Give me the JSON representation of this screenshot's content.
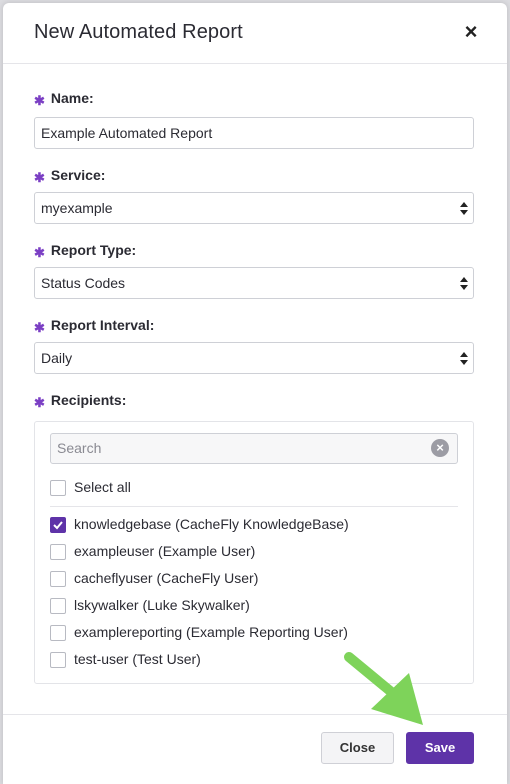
{
  "modal": {
    "title": "New Automated Report",
    "close_symbol": "×"
  },
  "form": {
    "required_marker": "✱",
    "name": {
      "label": "Name:",
      "value": "Example Automated Report"
    },
    "service": {
      "label": "Service:",
      "value": "myexample"
    },
    "report_type": {
      "label": "Report Type:",
      "value": "Status Codes"
    },
    "report_interval": {
      "label": "Report Interval:",
      "value": "Daily"
    },
    "recipients": {
      "label": "Recipients:",
      "search_placeholder": "Search",
      "select_all_label": "Select all",
      "users": [
        {
          "label": "knowledgebase (CacheFly KnowledgeBase)",
          "checked": true
        },
        {
          "label": "exampleuser (Example User)",
          "checked": false
        },
        {
          "label": "cacheflyuser (CacheFly User)",
          "checked": false
        },
        {
          "label": "lskywalker (Luke Skywalker)",
          "checked": false
        },
        {
          "label": "examplereporting (Example Reporting User)",
          "checked": false
        },
        {
          "label": "test-user (Test User)",
          "checked": false
        }
      ]
    }
  },
  "footer": {
    "close_label": "Close",
    "save_label": "Save"
  },
  "colors": {
    "accent": "#5e33a8",
    "required_marker": "#7b3fc4",
    "annotation_arrow": "#7ed35a"
  },
  "icons": [
    "close-icon",
    "select-arrows-icon",
    "clear-search-icon",
    "checkmark-icon",
    "pointer-arrow-icon"
  ]
}
